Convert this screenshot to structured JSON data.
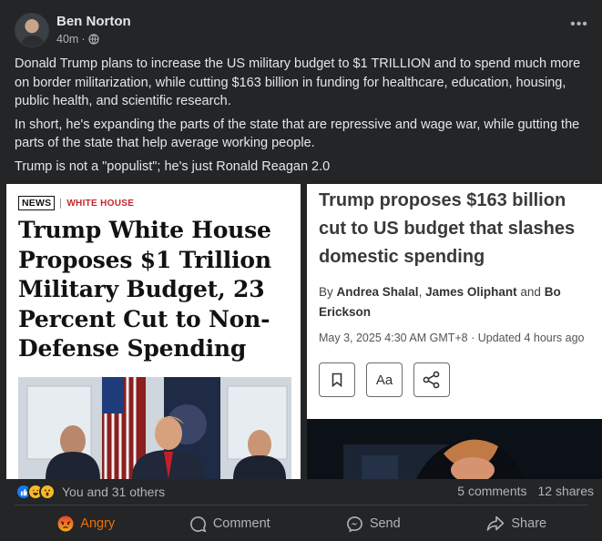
{
  "post": {
    "author": "Ben Norton",
    "time": "40m",
    "separator": "·",
    "paragraphs": [
      "Donald Trump plans to increase the US military budget to $1 TRILLION and to spend much more on border militarization, while cutting $163 billion in funding for healthcare, education, housing, public health, and scientific research.",
      "In short, he's expanding the parts of the state that are repressive and wage war, while gutting the parts of the state that help average working people.",
      "Trump is not a \"populist\"; he's just Ronald Reagan 2.0"
    ],
    "more_icon": "more-horizontal-icon",
    "privacy_icon": "globe-icon"
  },
  "preview_left": {
    "tag_primary": "NEWS",
    "tag_secondary": "WHITE HOUSE",
    "headline": "Trump White House Proposes $1 Trillion Military Budget, 23 Percent Cut to Non-Defense Spending"
  },
  "preview_right": {
    "headline": "Trump proposes $163 billion cut to US budget that slashes domestic spending",
    "by": "By",
    "author_1": "Andrea Shalal",
    "author_2": "James Oliphant",
    "and": "and",
    "author_3": "Bo Erickson",
    "comma": ",",
    "dateline": "May 3, 2025 4:30 AM GMT+8 · Updated 4 hours ago",
    "tools": {
      "bookmark_icon": "bookmark-icon",
      "text_size_label": "Aa",
      "share_icon": "share-icon"
    }
  },
  "engagement": {
    "reaction_icons": [
      "like-icon",
      "haha-icon",
      "wow-icon"
    ],
    "reaction_text": "You and 31 others",
    "comments": "5 comments",
    "shares": "12 shares"
  },
  "actions": {
    "reaction_label": "Angry",
    "comment_label": "Comment",
    "send_label": "Send",
    "share_label": "Share"
  },
  "colors": {
    "background": "#242526",
    "text": "#e4e6eb",
    "muted": "#b0b3b8",
    "angry": "#e9710f",
    "like_blue": "#1877f2",
    "tag_red": "#c4262e"
  }
}
